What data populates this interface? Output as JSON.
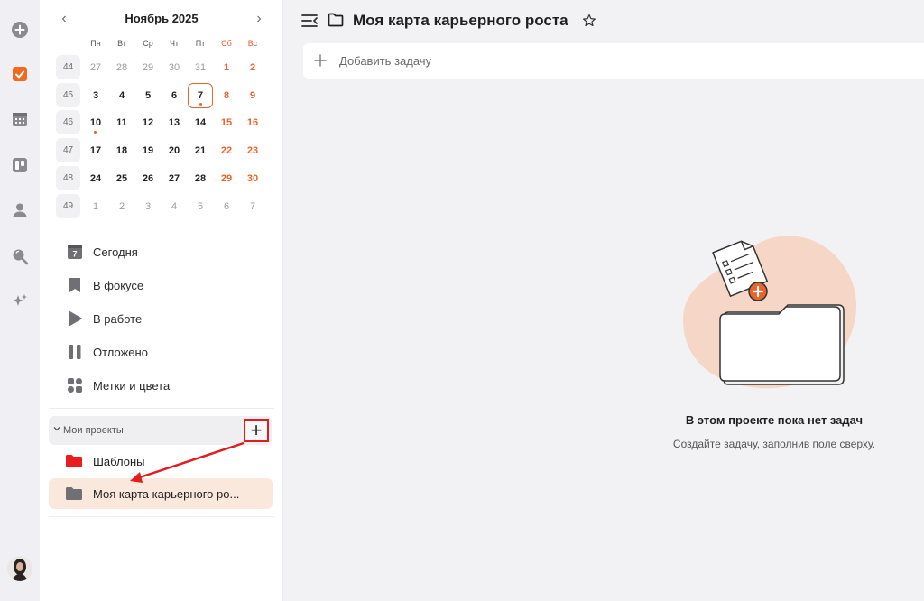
{
  "calendar": {
    "title": "Ноябрь 2025",
    "prev": "‹",
    "next": "›",
    "weekdays": [
      "Пн",
      "Вт",
      "Ср",
      "Чт",
      "Пт",
      "Сб",
      "Вс"
    ],
    "weeks": [
      {
        "num": "44",
        "days": [
          "27",
          "28",
          "29",
          "30",
          "31",
          "1",
          "2"
        ]
      },
      {
        "num": "45",
        "days": [
          "3",
          "4",
          "5",
          "6",
          "7",
          "8",
          "9"
        ]
      },
      {
        "num": "46",
        "days": [
          "10",
          "11",
          "12",
          "13",
          "14",
          "15",
          "16"
        ]
      },
      {
        "num": "47",
        "days": [
          "17",
          "18",
          "19",
          "20",
          "21",
          "22",
          "23"
        ]
      },
      {
        "num": "48",
        "days": [
          "24",
          "25",
          "26",
          "27",
          "28",
          "29",
          "30"
        ]
      },
      {
        "num": "49",
        "days": [
          "1",
          "2",
          "3",
          "4",
          "5",
          "6",
          "7"
        ]
      }
    ],
    "today": "7"
  },
  "nav": {
    "today_badge": "7",
    "items": [
      {
        "label": "Сегодня"
      },
      {
        "label": "В фокусе"
      },
      {
        "label": "В работе"
      },
      {
        "label": "Отложено"
      },
      {
        "label": "Метки и цвета"
      }
    ]
  },
  "projects": {
    "header": "Мои проекты",
    "add_label": "+",
    "items": [
      {
        "label": "Шаблоны"
      },
      {
        "label": "Моя карта карьерного ро..."
      }
    ]
  },
  "main": {
    "title": "Моя карта карьерного роста",
    "add_task_placeholder": "Добавить задачу",
    "empty_title": "В этом проекте пока нет задач",
    "empty_subtitle": "Создайте задачу, заполнив поле сверху."
  },
  "colors": {
    "accent": "#e8652b",
    "annotation": "#e11d1d",
    "active_project_bg": "#fbe8dc"
  }
}
